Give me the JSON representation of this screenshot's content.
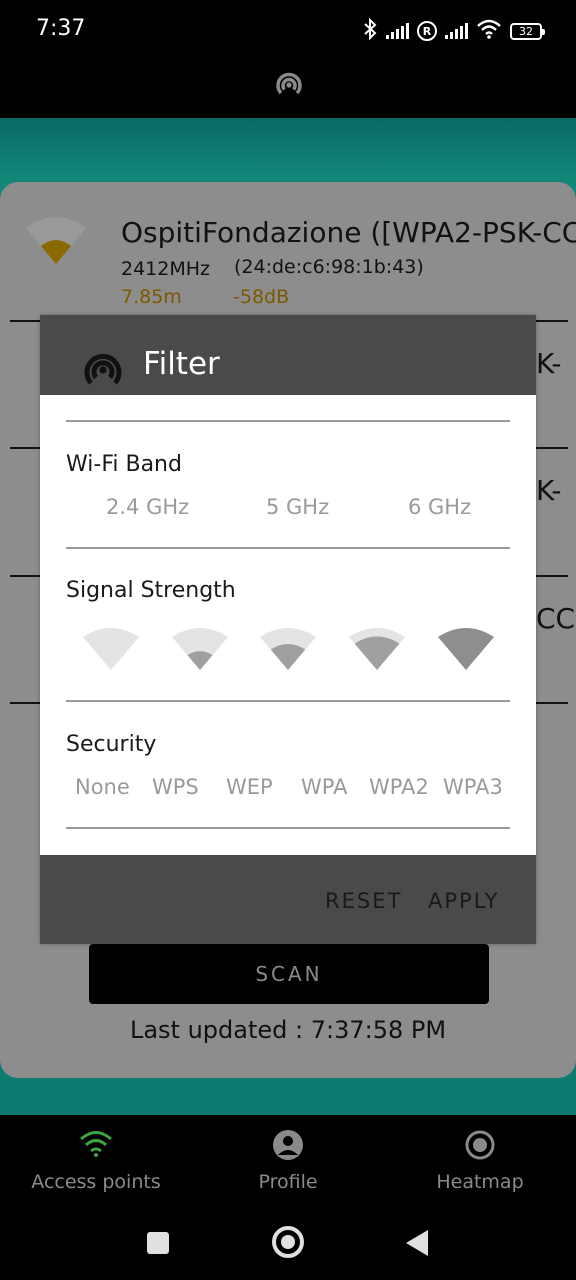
{
  "status_bar": {
    "time": "7:37",
    "battery": "32",
    "icons": [
      "bluetooth-icon",
      "cell-signal-icon",
      "roaming-icon",
      "cell-signal-icon",
      "wifi-icon",
      "battery-icon"
    ]
  },
  "colors": {
    "accent_signal": "#caa000",
    "teal": "#0e7a6f",
    "nav_active": "#3fa23f"
  },
  "access_points": [
    {
      "ssid": "OspitiFondazione ([WPA2-PSK-CC",
      "frequency": "2412MHz",
      "bssid": "(24:de:c6:98:1b:43)",
      "distance": "7.85m",
      "signal": "-58dB"
    },
    {
      "ssid_tail": "K-"
    },
    {
      "ssid_tail": "K-"
    },
    {
      "ssid_tail": "CC"
    }
  ],
  "dialog": {
    "title": "Filter",
    "wifi_band": {
      "title": "Wi-Fi Band",
      "options": [
        "2.4 GHz",
        "5 GHz",
        "6 GHz"
      ]
    },
    "signal_strength": {
      "title": "Signal Strength",
      "levels": [
        0,
        1,
        2,
        3,
        4
      ]
    },
    "security": {
      "title": "Security",
      "options": [
        "None",
        "WPS",
        "WEP",
        "WPA",
        "WPA2",
        "WPA3"
      ]
    },
    "reset_label": "RESET",
    "apply_label": "APPLY"
  },
  "scan_label": "SCAN",
  "last_updated": "Last updated : 7:37:58 PM",
  "bottom_nav": [
    {
      "label": "Access points",
      "icon": "wifi-icon",
      "active": true
    },
    {
      "label": "Profile",
      "icon": "profile-icon",
      "active": false
    },
    {
      "label": "Heatmap",
      "icon": "heatmap-icon",
      "active": false
    }
  ]
}
